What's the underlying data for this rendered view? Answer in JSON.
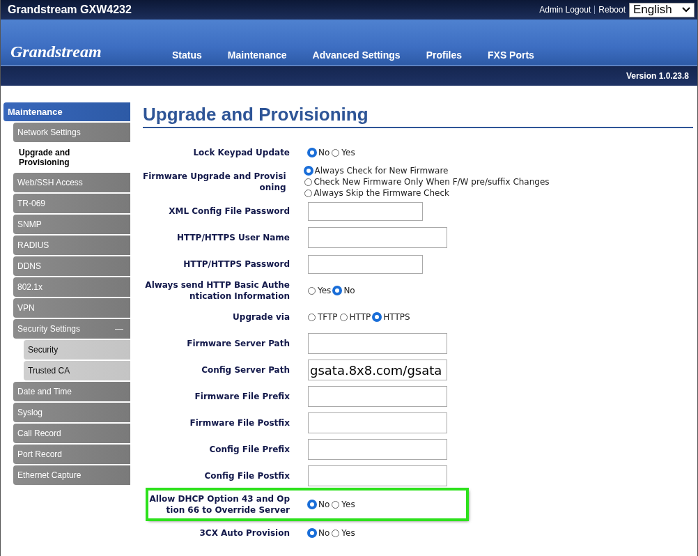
{
  "header": {
    "title": "Grandstream GXW4232",
    "links": [
      "Admin Logout",
      "Reboot"
    ],
    "language": "English",
    "logo": "Grandstream",
    "version": "Version 1.0.23.8"
  },
  "nav": [
    {
      "label": "Status",
      "selected": false
    },
    {
      "label": "Maintenance",
      "selected": false
    },
    {
      "label": "Advanced Settings",
      "selected": false
    },
    {
      "label": "Profiles",
      "selected": false
    },
    {
      "label": "FXS Ports",
      "selected": false
    }
  ],
  "sidebar": {
    "heading": "Maintenance",
    "items": [
      {
        "label": "Network Settings",
        "selected": false
      },
      {
        "label": "Upgrade and Provisioning",
        "selected": true
      },
      {
        "label": "Web/SSH Access",
        "selected": false
      },
      {
        "label": "TR-069",
        "selected": false
      },
      {
        "label": "SNMP",
        "selected": false
      },
      {
        "label": "RADIUS",
        "selected": false
      },
      {
        "label": "DDNS",
        "selected": false
      },
      {
        "label": "802.1x",
        "selected": false
      },
      {
        "label": "VPN",
        "selected": false
      },
      {
        "label": "Security Settings",
        "selected": false,
        "expanded": true,
        "toggle": "—",
        "children": [
          {
            "label": "Security",
            "selected": false
          },
          {
            "label": "Trusted CA",
            "selected": false
          }
        ]
      },
      {
        "label": "Date and Time",
        "selected": false
      },
      {
        "label": "Syslog",
        "selected": false
      },
      {
        "label": "Call Record",
        "selected": false
      },
      {
        "label": "Port Record",
        "selected": false
      },
      {
        "label": "Ethernet Capture",
        "selected": false
      }
    ]
  },
  "page": {
    "title": "Upgrade and Provisioning",
    "fields": [
      {
        "label": [
          "Lock Keypad Update"
        ],
        "kind": "radio",
        "highlighted": false,
        "options": [
          {
            "label": "No",
            "selected": true
          },
          {
            "label": "Yes",
            "selected": false
          }
        ]
      },
      {
        "label": [
          "Firmware Upgrade and Provisi",
          "oning"
        ],
        "kind": "radio-list",
        "highlighted": false,
        "options": [
          {
            "label": "Always Check for New Firmware",
            "selected": true
          },
          {
            "label": "Check New Firmware Only When F/W pre/suffix Changes",
            "selected": false
          },
          {
            "label": "Always Skip the Firmware Check",
            "selected": false
          }
        ]
      },
      {
        "label": [
          "XML Config File Password"
        ],
        "kind": "password",
        "highlighted": false
      },
      {
        "label": [
          "HTTP/HTTPS User Name"
        ],
        "kind": "text",
        "highlighted": false
      },
      {
        "label": [
          "HTTP/HTTPS Password"
        ],
        "kind": "password",
        "highlighted": false
      },
      {
        "label": [
          "Always send HTTP Basic Authe",
          "ntication Information"
        ],
        "kind": "radio",
        "highlighted": false,
        "options": [
          {
            "label": "Yes",
            "selected": false
          },
          {
            "label": "No",
            "selected": true
          }
        ]
      },
      {
        "label": [
          "Upgrade via"
        ],
        "kind": "radio",
        "highlighted": false,
        "options": [
          {
            "label": "TFTP",
            "selected": false
          },
          {
            "label": "HTTP",
            "selected": false
          },
          {
            "label": "HTTPS",
            "selected": true
          }
        ]
      },
      {
        "label": [
          "Firmware Server Path"
        ],
        "kind": "text",
        "highlighted": false
      },
      {
        "label": [
          "Config Server Path"
        ],
        "kind": "text",
        "highlighted": false,
        "value": "gsata.8x8.com/gsata"
      },
      {
        "label": [
          "Firmware File Prefix"
        ],
        "kind": "text",
        "highlighted": false
      },
      {
        "label": [
          "Firmware File Postfix"
        ],
        "kind": "text",
        "highlighted": false
      },
      {
        "label": [
          "Config File Prefix"
        ],
        "kind": "text",
        "highlighted": false
      },
      {
        "label": [
          "Config File Postfix"
        ],
        "kind": "text",
        "highlighted": false
      },
      {
        "label": [
          "Allow DHCP Option 43 and Op",
          "tion 66 to Override Server"
        ],
        "kind": "radio",
        "highlighted": true,
        "options": [
          {
            "label": "No",
            "selected": true
          },
          {
            "label": "Yes",
            "selected": false
          }
        ]
      },
      {
        "label": [
          "3CX Auto Provision"
        ],
        "kind": "radio",
        "highlighted": false,
        "options": [
          {
            "label": "No",
            "selected": true
          },
          {
            "label": "Yes",
            "selected": false
          }
        ]
      }
    ]
  }
}
